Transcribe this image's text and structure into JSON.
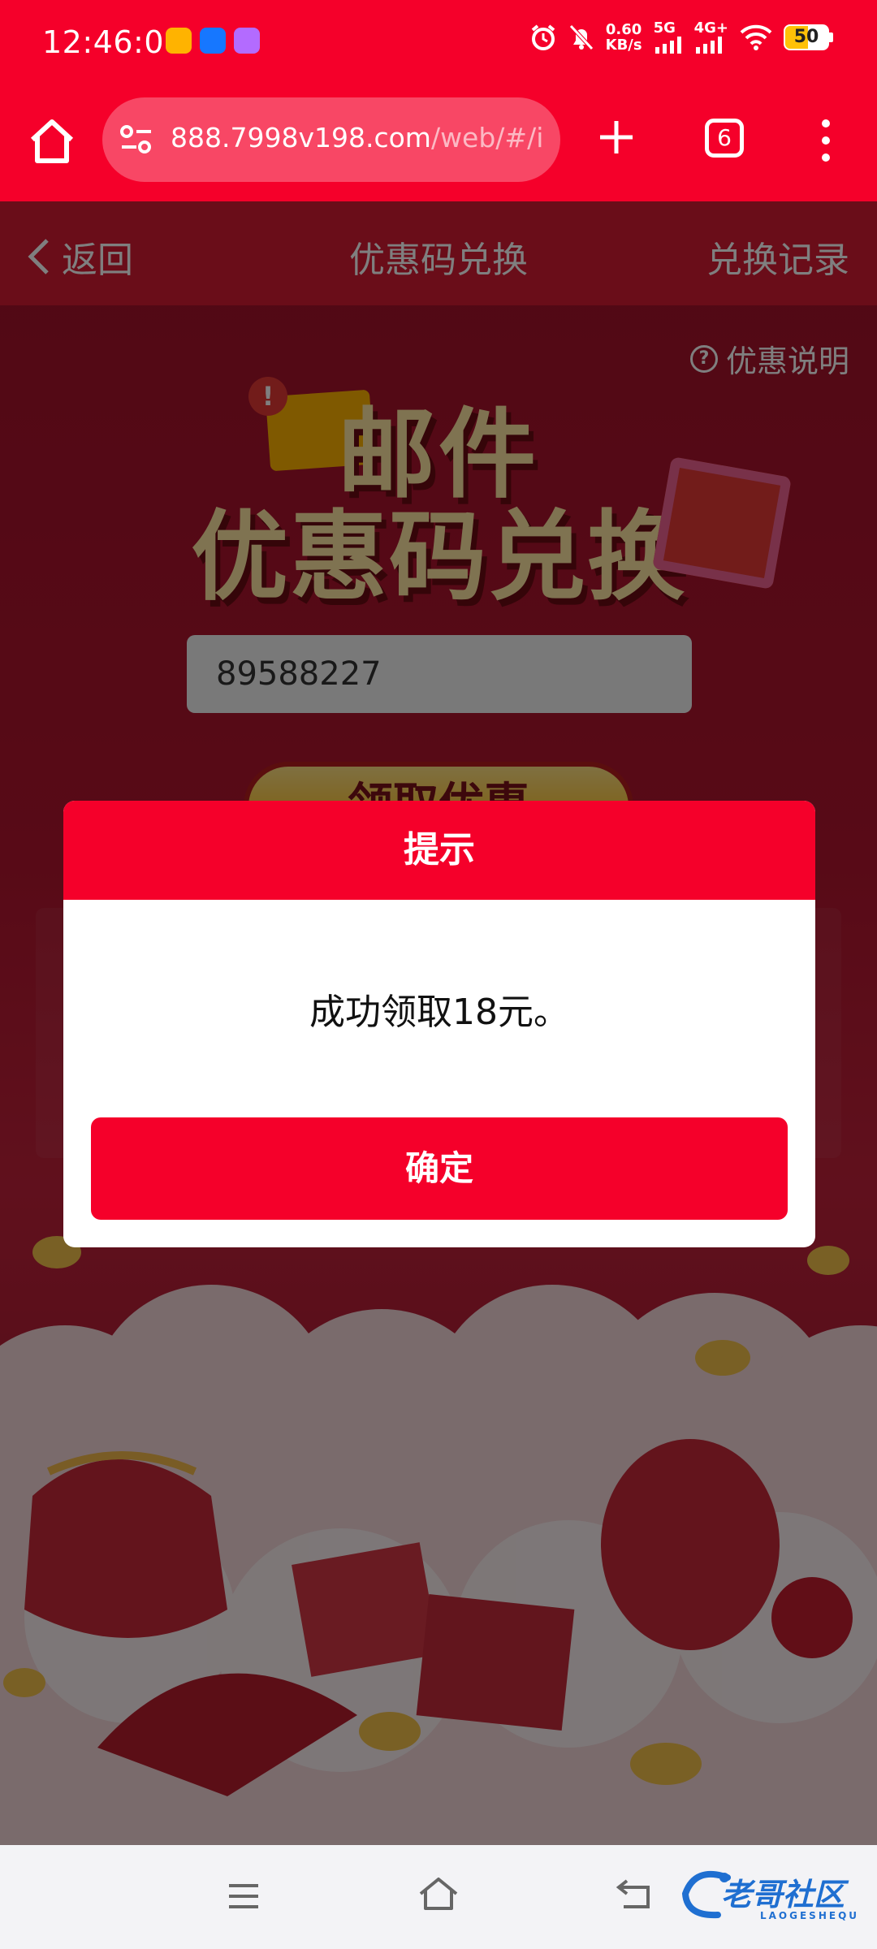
{
  "status_bar": {
    "time": "12:46:00",
    "speed_value": "0.60",
    "speed_unit": "KB/s",
    "network_5g": "5G",
    "network_4g": "4G+",
    "battery": "50"
  },
  "browser": {
    "url_main": "888.7998v198.com",
    "url_rest": "/web/#/inte",
    "tab_count": "6"
  },
  "nav": {
    "back_label": "返回",
    "title": "优惠码兑换",
    "right_label": "兑换记录"
  },
  "page": {
    "promo_note": "优惠说明",
    "hero_line1": "邮件",
    "hero_line2": "优惠码兑换",
    "code_value": "89588227",
    "claim_button": "领取优惠"
  },
  "dialog": {
    "title": "提示",
    "message": "成功领取18元。",
    "confirm": "确定"
  },
  "watermark": {
    "text": "老哥社区",
    "sub": "LAOGESHEQU"
  },
  "colors": {
    "brand_red": "#f5002a",
    "overlay": "rgba(0,0,0,0.5)"
  }
}
